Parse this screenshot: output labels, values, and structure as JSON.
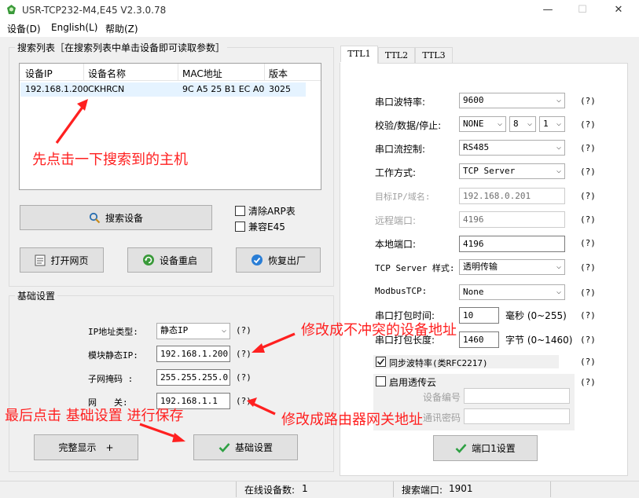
{
  "window": {
    "title": "USR-TCP232-M4,E45 V2.3.0.78",
    "minimize": "—",
    "maximize": "☐",
    "close": "✕"
  },
  "menu": [
    "设备(D)",
    "English(L)",
    "帮助(Z)"
  ],
  "search": {
    "group_title": "搜索列表［在搜索列表中单击设备即可读取参数］",
    "columns": [
      "设备IP",
      "设备名称",
      "MAC地址",
      "版本"
    ],
    "rows": [
      {
        "ip": "192.168.1.200",
        "name": "CKHRCN",
        "mac": "9C A5 25 B1 EC A0",
        "version": "3025"
      }
    ],
    "search_button": "搜索设备",
    "clear_arp": "清除ARP表",
    "compat_e45": "兼容E45",
    "open_web": "打开网页",
    "restart": "设备重启",
    "factory_reset": "恢复出厂"
  },
  "basic": {
    "group_title": "基础设置",
    "ip_type_label": "IP地址类型:",
    "ip_type_value": "静态IP",
    "static_ip_label": "模块静态IP:",
    "static_ip_value": "192.168.1.200",
    "subnet_label": "子网掩码 :",
    "subnet_value": "255.255.255.0",
    "gateway_label": "网　　关:",
    "gateway_value": "192.168.1.1",
    "help": "(?)",
    "full_display": "完整显示　+",
    "save_button": "基础设置"
  },
  "tabs": [
    "TTL1",
    "TTL2",
    "TTL3"
  ],
  "ttl": {
    "baud_label": "串口波特率:",
    "baud_value": "9600",
    "parity_label": "校验/数据/停止:",
    "parity_value": "NONE",
    "data_bits": "8",
    "stop_bits": "1",
    "flow_label": "串口流控制:",
    "flow_value": "RS485",
    "mode_label": "工作方式:",
    "mode_value": "TCP Server",
    "target_label": "目标IP/域名:",
    "target_value": "192.168.0.201",
    "remote_port_label": "远程端口:",
    "remote_port_value": "4196",
    "local_port_label": "本地端口:",
    "local_port_value": "4196",
    "server_style_label": "TCP Server 样式:",
    "server_style_value": "透明传输",
    "modbus_label": "ModbusTCP:",
    "modbus_value": "None",
    "pack_time_label": "串口打包时间:",
    "pack_time_value": "10",
    "pack_time_unit": "毫秒 (0~255)",
    "pack_len_label": "串口打包长度:",
    "pack_len_value": "1460",
    "pack_len_unit": "字节 (0~1460)",
    "sync_baud": "同步波特率(类RFC2217)",
    "cloud": "启用透传云",
    "device_no_label": "设备编号",
    "device_pwd_label": "通讯密码",
    "help": "(?)",
    "port_save": "端口1设置"
  },
  "annotations": {
    "click_host": "先点击一下搜索到的主机",
    "change_ip": "修改成不冲突的设备地址",
    "change_gateway": "修改成路由器网关地址",
    "save_hint": "最后点击 基础设置 进行保存"
  },
  "status": {
    "online_label": "在线设备数:",
    "online_value": "1",
    "search_port_label": "搜索端口:",
    "search_port_value": "1901"
  },
  "colors": {
    "annotation": "#ff2020",
    "selected_row": "#e5f3ff",
    "check_icon": "#2ea043"
  }
}
